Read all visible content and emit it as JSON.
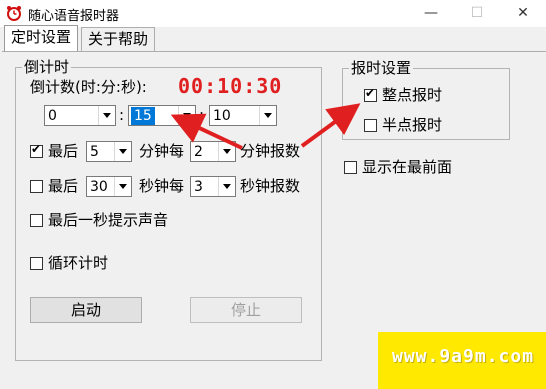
{
  "window": {
    "title": "随心语音报时器",
    "minimize_glyph": "—",
    "maximize_glyph": "☐",
    "close_glyph": "✕"
  },
  "tabs": [
    {
      "label": "定时设置",
      "active": true
    },
    {
      "label": "关于帮助",
      "active": false
    }
  ],
  "countdown": {
    "group_title": "倒计时",
    "label": "倒计数(时:分:秒):",
    "display": "00:10:30",
    "hours": "0",
    "minutes": "15",
    "seconds": "10",
    "separator": ":",
    "rows": [
      {
        "checked": true,
        "prefix": "最后",
        "value1": "5",
        "middle": "分钟每",
        "value2": "2",
        "suffix": "分钟报数"
      },
      {
        "checked": false,
        "prefix": "最后",
        "value1": "30",
        "middle": "秒钟每",
        "value2": "3",
        "suffix": "秒钟报数"
      }
    ],
    "last_second_sound": {
      "checked": false,
      "label": "最后一秒提示声音"
    },
    "loop": {
      "checked": false,
      "label": "循环计时"
    },
    "start_button": "启动",
    "stop_button": "停止"
  },
  "chime": {
    "group_title": "报时设置",
    "on_hour": {
      "checked": true,
      "label": "整点报时"
    },
    "half_hour": {
      "checked": false,
      "label": "半点报时"
    }
  },
  "always_on_top": {
    "checked": false,
    "label": "显示在最前面"
  },
  "watermark": "www.9a9m.com",
  "colors": {
    "timer_red": "#e02020",
    "arrow_red": "#e02020",
    "selection_blue": "#0078d7",
    "watermark_yellow": "#ffe900"
  }
}
